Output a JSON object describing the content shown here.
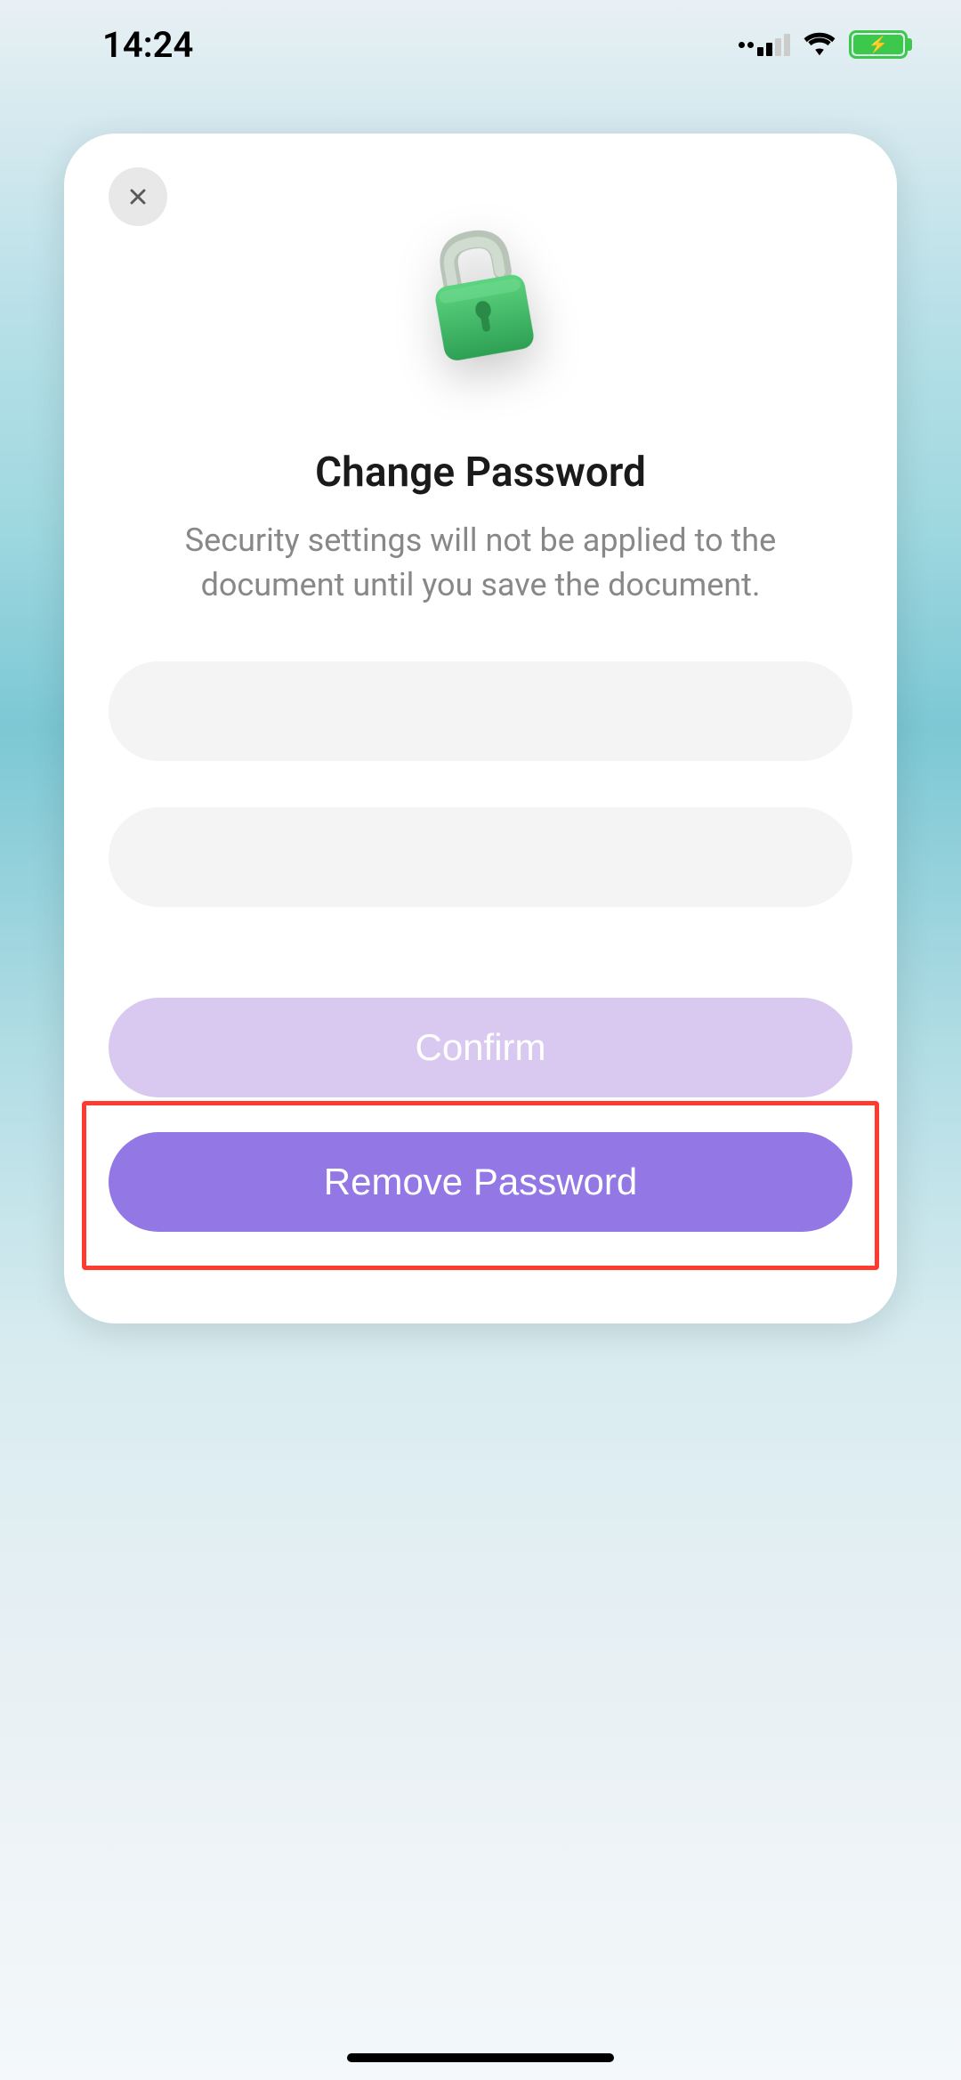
{
  "statusBar": {
    "time": "14:24"
  },
  "modal": {
    "title": "Change Password",
    "subtitle": "Security settings will not be applied to the document until you save the document.",
    "input1_value": "",
    "input2_value": "",
    "confirmLabel": "Confirm",
    "removeLabel": "Remove Password"
  }
}
